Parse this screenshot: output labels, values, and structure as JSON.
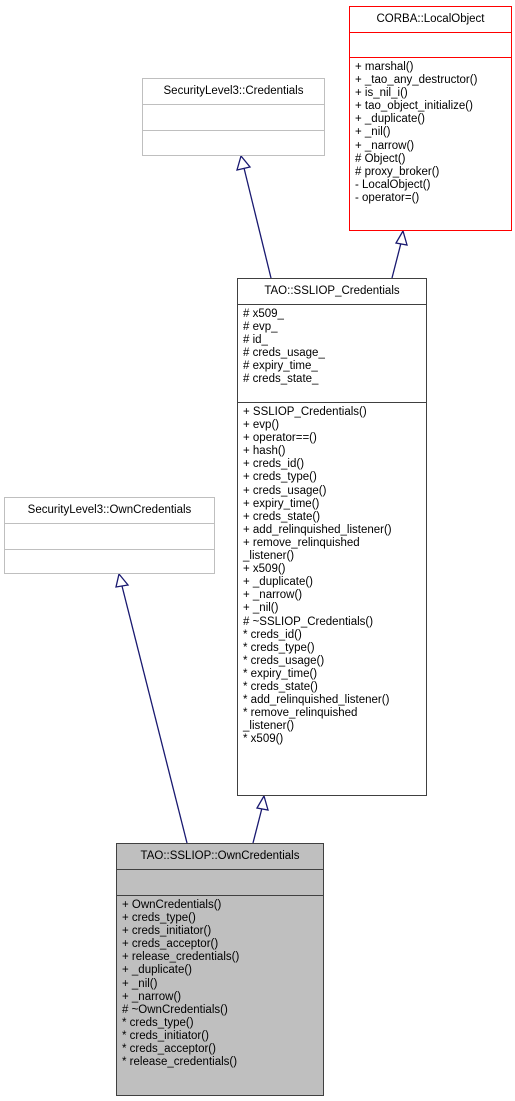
{
  "diagram": {
    "classes": {
      "corba_local_object": {
        "name": "CORBA::LocalObject",
        "attributes": [],
        "methods": [
          "+ marshal()",
          "+ _tao_any_destructor()",
          "+ is_nil_i()",
          "+ tao_object_initialize()",
          "+ _duplicate()",
          "+ _nil()",
          "+ _narrow()",
          "# Object()",
          "# proxy_broker()",
          "- LocalObject()",
          "- operator=()"
        ]
      },
      "sl3_credentials": {
        "name": "SecurityLevel3::Credentials",
        "attributes": [],
        "methods": []
      },
      "sslio_credentials": {
        "name": "TAO::SSLIOP_Credentials",
        "attributes": [
          "# x509_",
          "# evp_",
          "# id_",
          "# creds_usage_",
          "# expiry_time_",
          "# creds_state_"
        ],
        "methods": [
          "+ SSLIOP_Credentials()",
          "+ evp()",
          "+ operator==()",
          "+ hash()",
          "+ creds_id()",
          "+ creds_type()",
          "+ creds_usage()",
          "+ expiry_time()",
          "+ creds_state()",
          "+ add_relinquished_listener()",
          "+ remove_relinquished",
          "_listener()",
          "+ x509()",
          "+ _duplicate()",
          "+ _narrow()",
          "+ _nil()",
          "# ~SSLIOP_Credentials()",
          "* creds_id()",
          "* creds_type()",
          "* creds_usage()",
          "* expiry_time()",
          "* creds_state()",
          "* add_relinquished_listener()",
          "* remove_relinquished",
          "_listener()",
          "* x509()"
        ]
      },
      "sl3_own_credentials": {
        "name": "SecurityLevel3::OwnCredentials",
        "attributes": [],
        "methods": []
      },
      "sslio_own_credentials": {
        "name": "TAO::SSLIOP::OwnCredentials",
        "attributes": [],
        "methods": [
          "+ OwnCredentials()",
          "+ creds_type()",
          "+ creds_initiator()",
          "+ creds_acceptor()",
          "+ release_credentials()",
          "+ _duplicate()",
          "+ _nil()",
          "+ _narrow()",
          "# ~OwnCredentials()",
          "* creds_type()",
          "* creds_initiator()",
          "* creds_acceptor()",
          "* release_credentials()"
        ]
      }
    },
    "relations": [
      {
        "from": "sslio_credentials",
        "to": "sl3_credentials",
        "type": "inheritance"
      },
      {
        "from": "sslio_credentials",
        "to": "corba_local_object",
        "type": "inheritance"
      },
      {
        "from": "sslio_own_credentials",
        "to": "sl3_own_credentials",
        "type": "inheritance"
      },
      {
        "from": "sslio_own_credentials",
        "to": "sslio_credentials",
        "type": "inheritance"
      }
    ],
    "colors": {
      "edge": "#191970",
      "focus_fill": "#bfbfbf",
      "external_border": "#bfbfbf",
      "undocumented_border": "#ff0000",
      "border": "#404040"
    }
  }
}
